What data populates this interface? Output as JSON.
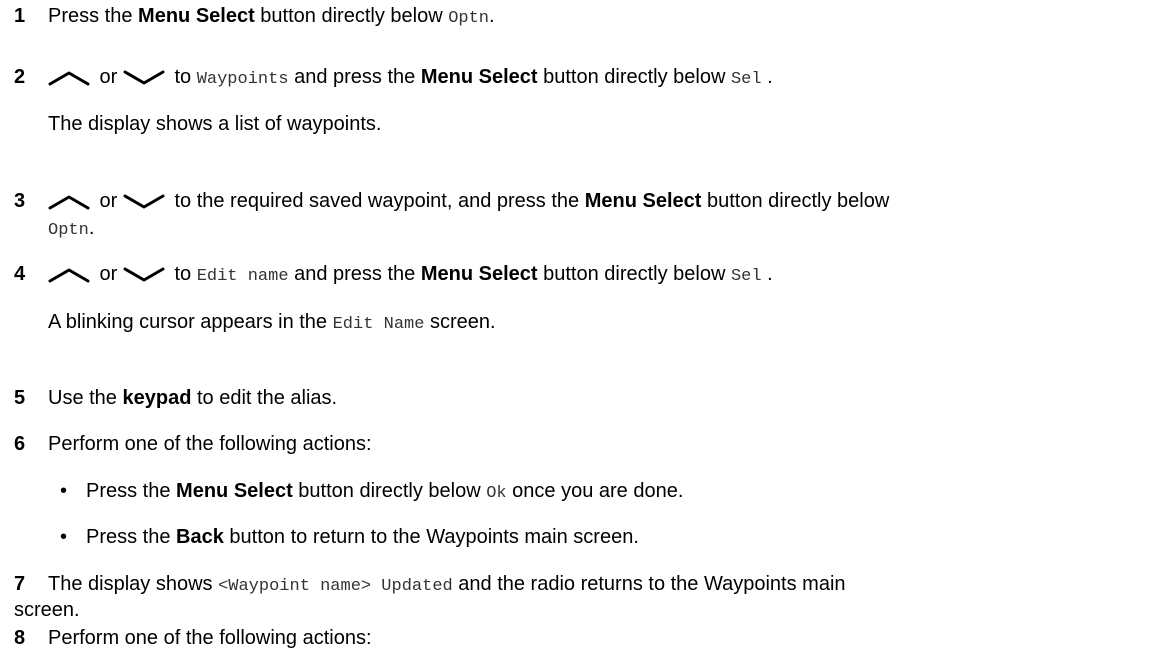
{
  "steps": [
    {
      "num": "1",
      "t1": "Press the ",
      "b1": "Menu Select",
      "t2": " button directly below ",
      "m1": "Optn",
      "t3": "."
    },
    {
      "num": "2",
      "or": " or ",
      "t1": " to ",
      "m1": "Waypoints",
      "t2": " and press the ",
      "b1": "Menu Select",
      "t3": " button directly below ",
      "m2": "Sel",
      "t4": " .",
      "sub": "The display shows a list of waypoints."
    },
    {
      "num": "3",
      "or": " or ",
      "t1": " to the required saved waypoint, and press the ",
      "b1": "Menu Select",
      "t2": " button directly below",
      "m1": "Optn",
      "t3": "."
    },
    {
      "num": "4",
      "or": " or ",
      "t1": " to ",
      "m1": "Edit name",
      "t2": " and press the ",
      "b1": "Menu Select",
      "t3": " button directly below ",
      "m2": "Sel",
      "t4": " .",
      "sub1": "A blinking cursor appears in the ",
      "sub_m": "Edit Name",
      "sub2": " screen."
    },
    {
      "num": "5",
      "t1": "Use the ",
      "b1": "keypad",
      "t2": " to edit the alias."
    },
    {
      "num": "6",
      "t1": "Perform one of the following actions:",
      "bullets": [
        {
          "t1": "Press the ",
          "b1": "Menu Select",
          "t2": " button directly below ",
          "m1": "Ok",
          "t3": " once you are done."
        },
        {
          "t1": "Press the ",
          "b1": "Back",
          "t2": " button to return to the Waypoints main screen."
        }
      ]
    },
    {
      "num": "7",
      "t1": "The display shows ",
      "m1": "<Waypoint name> Updated",
      "t2": " and the radio returns to the Waypoints main",
      "t3": "screen."
    },
    {
      "num": "8",
      "t1": "Perform one of the following actions:"
    }
  ],
  "icons": {
    "up": "chevron-up-icon",
    "down": "chevron-down-icon",
    "bullet": "•"
  }
}
